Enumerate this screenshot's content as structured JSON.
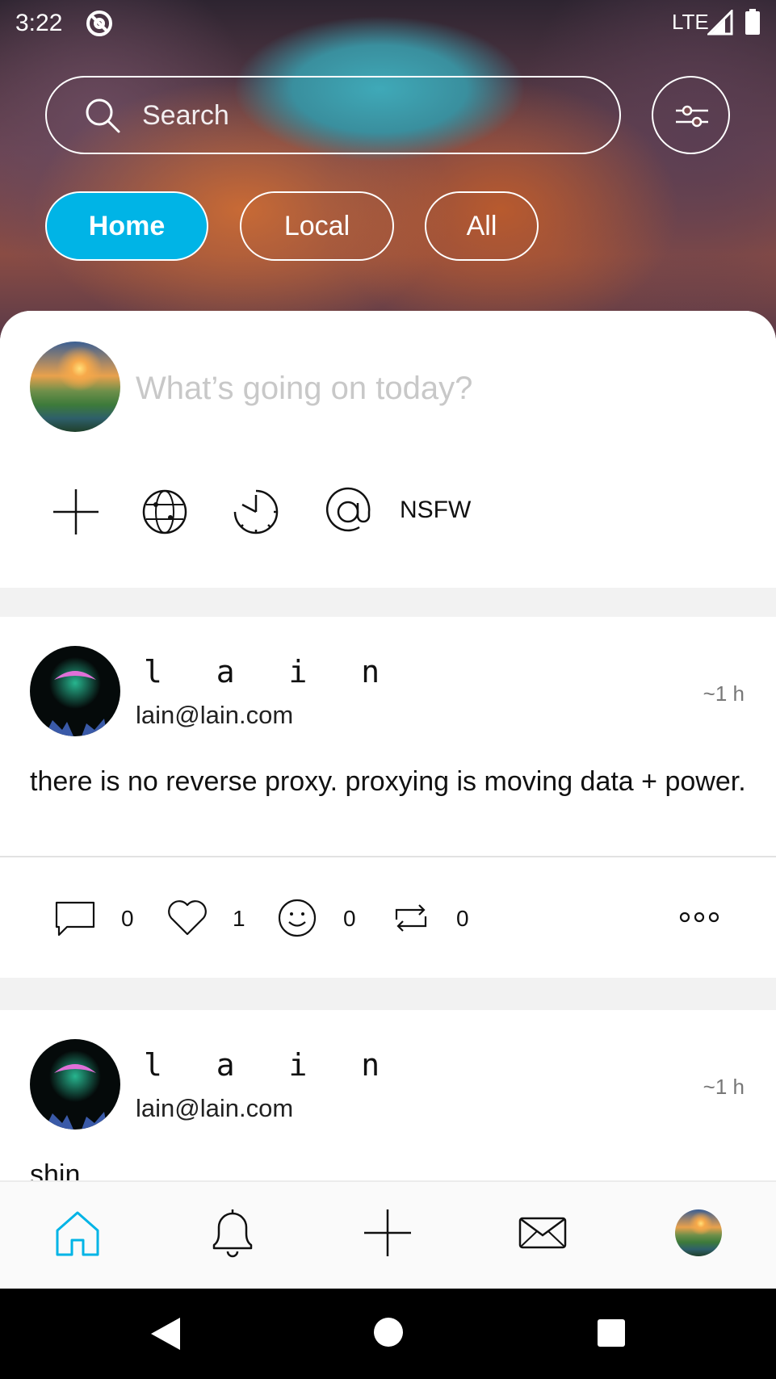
{
  "status_bar": {
    "time": "3:22",
    "network": "LTE",
    "icons": [
      "at-sign-icon",
      "signal-icon",
      "battery-icon"
    ]
  },
  "search": {
    "placeholder": "Search",
    "icon": "search-icon",
    "filter_icon": "sliders-icon"
  },
  "timeline_tabs": [
    {
      "label": "Home",
      "active": true
    },
    {
      "label": "Local",
      "active": false
    },
    {
      "label": "All",
      "active": false
    }
  ],
  "composer": {
    "placeholder": "What’s going on today?",
    "tools": [
      "add-icon",
      "globe-icon",
      "schedule-icon",
      "mention-icon"
    ],
    "nsfw_label": "NSFW"
  },
  "posts": [
    {
      "display_name": "l a i n",
      "handle": "lain@lain.com",
      "time": "~1 h",
      "body": "there is no reverse proxy. proxying is moving data + power.",
      "replies": "0",
      "likes": "1",
      "reactions": "0",
      "boosts": "0"
    },
    {
      "display_name": "l a i n",
      "handle": "lain@lain.com",
      "time": "~1 h",
      "body": "shin"
    }
  ],
  "bottom_nav": [
    "home-icon",
    "bell-icon",
    "plus-icon",
    "mail-icon",
    "profile-avatar"
  ],
  "colors": {
    "accent": "#00b4e6",
    "text": "#111111",
    "muted": "#777777",
    "placeholder": "#c8c8c8"
  }
}
